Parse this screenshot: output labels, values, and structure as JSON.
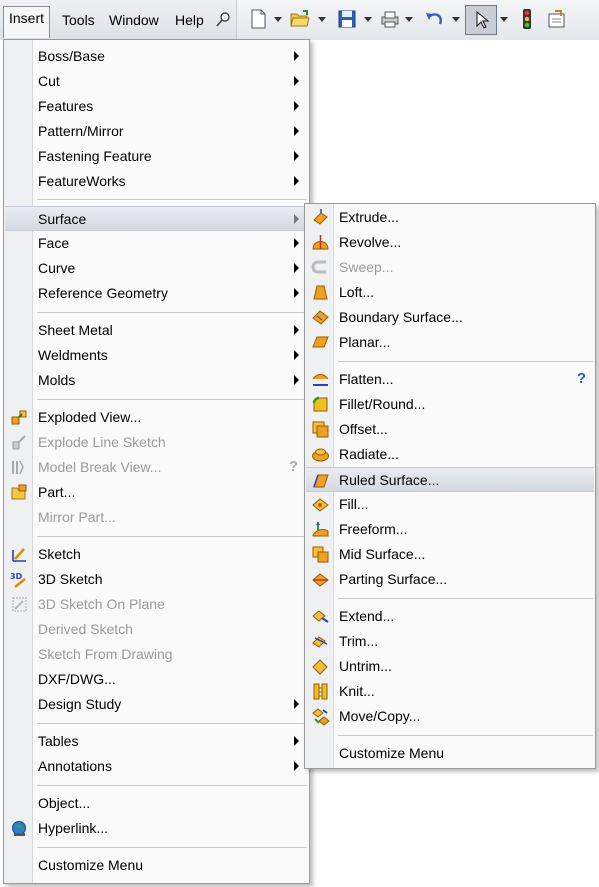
{
  "menubar": {
    "items": [
      {
        "label": "Insert"
      },
      {
        "label": "Tools"
      },
      {
        "label": "Window"
      },
      {
        "label": "Help"
      }
    ]
  },
  "toolbar": {
    "icons": [
      "pin-icon",
      "new-document-icon",
      "open-folder-icon",
      "save-icon",
      "print-icon",
      "undo-icon",
      "select-arrow-icon",
      "traffic-light-icon",
      "options-icon"
    ]
  },
  "insert_menu": {
    "items": [
      {
        "label": "Boss/Base",
        "submenu": true
      },
      {
        "label": "Cut",
        "submenu": true
      },
      {
        "label": "Features",
        "submenu": true
      },
      {
        "label": "Pattern/Mirror",
        "submenu": true
      },
      {
        "label": "Fastening Feature",
        "submenu": true
      },
      {
        "label": "FeatureWorks",
        "submenu": true
      },
      {
        "label": "Surface",
        "submenu": true
      },
      {
        "label": "Face",
        "submenu": true
      },
      {
        "label": "Curve",
        "submenu": true
      },
      {
        "label": "Reference Geometry",
        "submenu": true
      },
      {
        "label": "Sheet Metal",
        "submenu": true
      },
      {
        "label": "Weldments",
        "submenu": true
      },
      {
        "label": "Molds",
        "submenu": true
      },
      {
        "label": "Exploded View..."
      },
      {
        "label": "Explode Line Sketch"
      },
      {
        "label": "Model Break View..."
      },
      {
        "label": "Part..."
      },
      {
        "label": "Mirror Part..."
      },
      {
        "label": "Sketch"
      },
      {
        "label": "3D Sketch"
      },
      {
        "label": "3D Sketch On Plane"
      },
      {
        "label": "Derived Sketch"
      },
      {
        "label": "Sketch From Drawing"
      },
      {
        "label": "DXF/DWG..."
      },
      {
        "label": "Design Study",
        "submenu": true
      },
      {
        "label": "Tables",
        "submenu": true
      },
      {
        "label": "Annotations",
        "submenu": true
      },
      {
        "label": "Object..."
      },
      {
        "label": "Hyperlink..."
      },
      {
        "label": "Customize Menu"
      }
    ]
  },
  "surface_menu": {
    "items": [
      {
        "label": "Extrude..."
      },
      {
        "label": "Revolve..."
      },
      {
        "label": "Sweep..."
      },
      {
        "label": "Loft..."
      },
      {
        "label": "Boundary Surface..."
      },
      {
        "label": "Planar..."
      },
      {
        "label": "Flatten..."
      },
      {
        "label": "Fillet/Round..."
      },
      {
        "label": "Offset..."
      },
      {
        "label": "Radiate..."
      },
      {
        "label": "Ruled Surface..."
      },
      {
        "label": "Fill..."
      },
      {
        "label": "Freeform..."
      },
      {
        "label": "Mid Surface..."
      },
      {
        "label": "Parting Surface..."
      },
      {
        "label": "Extend..."
      },
      {
        "label": "Trim..."
      },
      {
        "label": "Untrim..."
      },
      {
        "label": "Knit..."
      },
      {
        "label": "Move/Copy..."
      },
      {
        "label": "Customize Menu"
      }
    ]
  },
  "help_glyph": "?",
  "colors": {
    "menu_bg": "#fafafa",
    "gutter_bg": "#eef0f2",
    "disabled_text": "#9a9a9a",
    "highlight": "#d4d9e1",
    "surface_icon_orange": "#f0a020",
    "help_blue": "#1f5fbf"
  }
}
